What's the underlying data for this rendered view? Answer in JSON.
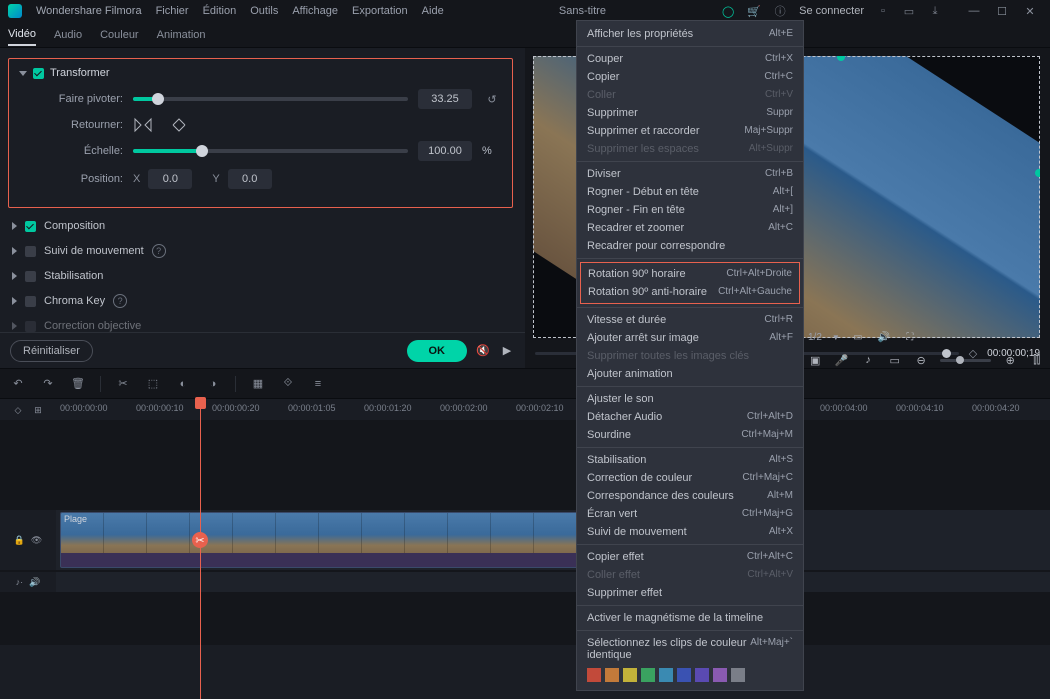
{
  "app": {
    "brand": "Wondershare Filmora",
    "title": "Sans-titre",
    "signin": "Se connecter"
  },
  "menubar": [
    "Fichier",
    "Édition",
    "Outils",
    "Affichage",
    "Exportation",
    "Aide"
  ],
  "tabs": [
    "Vidéo",
    "Audio",
    "Couleur",
    "Animation"
  ],
  "panel": {
    "transform": {
      "title": "Transformer",
      "rotate_label": "Faire pivoter:",
      "rotate_val": "33.25",
      "flip_label": "Retourner:",
      "scale_label": "Échelle:",
      "scale_val": "100.00",
      "scale_unit": "%",
      "pos_label": "Position:",
      "x": "X",
      "x_val": "0.0",
      "y": "Y",
      "y_val": "0.0"
    },
    "sections": [
      "Composition",
      "Suivi de mouvement",
      "Stabilisation",
      "Chroma Key",
      "Correction objective"
    ],
    "reset": "Réinitialiser",
    "ok": "OK"
  },
  "preview": {
    "ratio": "1/2",
    "timecode": "00:00:00;19"
  },
  "context": {
    "g1": [
      [
        "Afficher les propriétés",
        "Alt+E",
        false
      ]
    ],
    "g2": [
      [
        "Couper",
        "Ctrl+X",
        false
      ],
      [
        "Copier",
        "Ctrl+C",
        false
      ],
      [
        "Coller",
        "Ctrl+V",
        true
      ],
      [
        "Supprimer",
        "Suppr",
        false
      ],
      [
        "Supprimer et raccorder",
        "Maj+Suppr",
        false
      ],
      [
        "Supprimer les espaces",
        "Alt+Suppr",
        true
      ]
    ],
    "g3": [
      [
        "Diviser",
        "Ctrl+B",
        false
      ],
      [
        "Rogner - Début en tête",
        "Alt+[",
        false
      ],
      [
        "Rogner - Fin en tête",
        "Alt+]",
        false
      ],
      [
        "Recadrer et zoomer",
        "Alt+C",
        false
      ],
      [
        "Recadrer pour correspondre",
        "",
        false
      ]
    ],
    "hl": [
      [
        "Rotation 90º horaire",
        "Ctrl+Alt+Droite",
        false
      ],
      [
        "Rotation 90º anti-horaire",
        "Ctrl+Alt+Gauche",
        false
      ]
    ],
    "g4": [
      [
        "Vitesse et durée",
        "Ctrl+R",
        false
      ],
      [
        "Ajouter arrêt sur image",
        "Alt+F",
        false
      ],
      [
        "Supprimer toutes les images clés",
        "",
        true
      ],
      [
        "Ajouter animation",
        "",
        false
      ]
    ],
    "g5": [
      [
        "Ajuster le son",
        "",
        false
      ],
      [
        "Détacher Audio",
        "Ctrl+Alt+D",
        false
      ],
      [
        "Sourdine",
        "Ctrl+Maj+M",
        false
      ]
    ],
    "g6": [
      [
        "Stabilisation",
        "Alt+S",
        false
      ],
      [
        "Correction de couleur",
        "Ctrl+Maj+C",
        false
      ],
      [
        "Correspondance des couleurs",
        "Alt+M",
        false
      ],
      [
        "Écran vert",
        "Ctrl+Maj+G",
        false
      ],
      [
        "Suivi de mouvement",
        "Alt+X",
        false
      ]
    ],
    "g7": [
      [
        "Copier effet",
        "Ctrl+Alt+C",
        false
      ],
      [
        "Coller effet",
        "Ctrl+Alt+V",
        true
      ],
      [
        "Supprimer effet",
        "",
        false
      ]
    ],
    "g8": [
      [
        "Activer le magnétisme de la timeline",
        "",
        false
      ]
    ],
    "g9": [
      [
        "Sélectionnez les clips de couleur identique",
        "Alt+Maj+`",
        false
      ]
    ],
    "swatches": [
      "#c24a3a",
      "#c27a3a",
      "#c2b23a",
      "#3aa260",
      "#3a8ab2",
      "#3a52b2",
      "#5a4ab2",
      "#8a5ab2",
      "#7a7e88"
    ]
  },
  "ruler": [
    "00:00:00:00",
    "00:00:00:10",
    "00:00:00:20",
    "00:00:01:05",
    "00:00:01:20",
    "00:00:02:00",
    "00:00:02:10",
    "",
    "00:00:04:00",
    "00:00:04:10",
    "00:00:04:20"
  ],
  "clip": {
    "name": "Plage"
  },
  "tracks": {
    "audio": "♪·"
  }
}
